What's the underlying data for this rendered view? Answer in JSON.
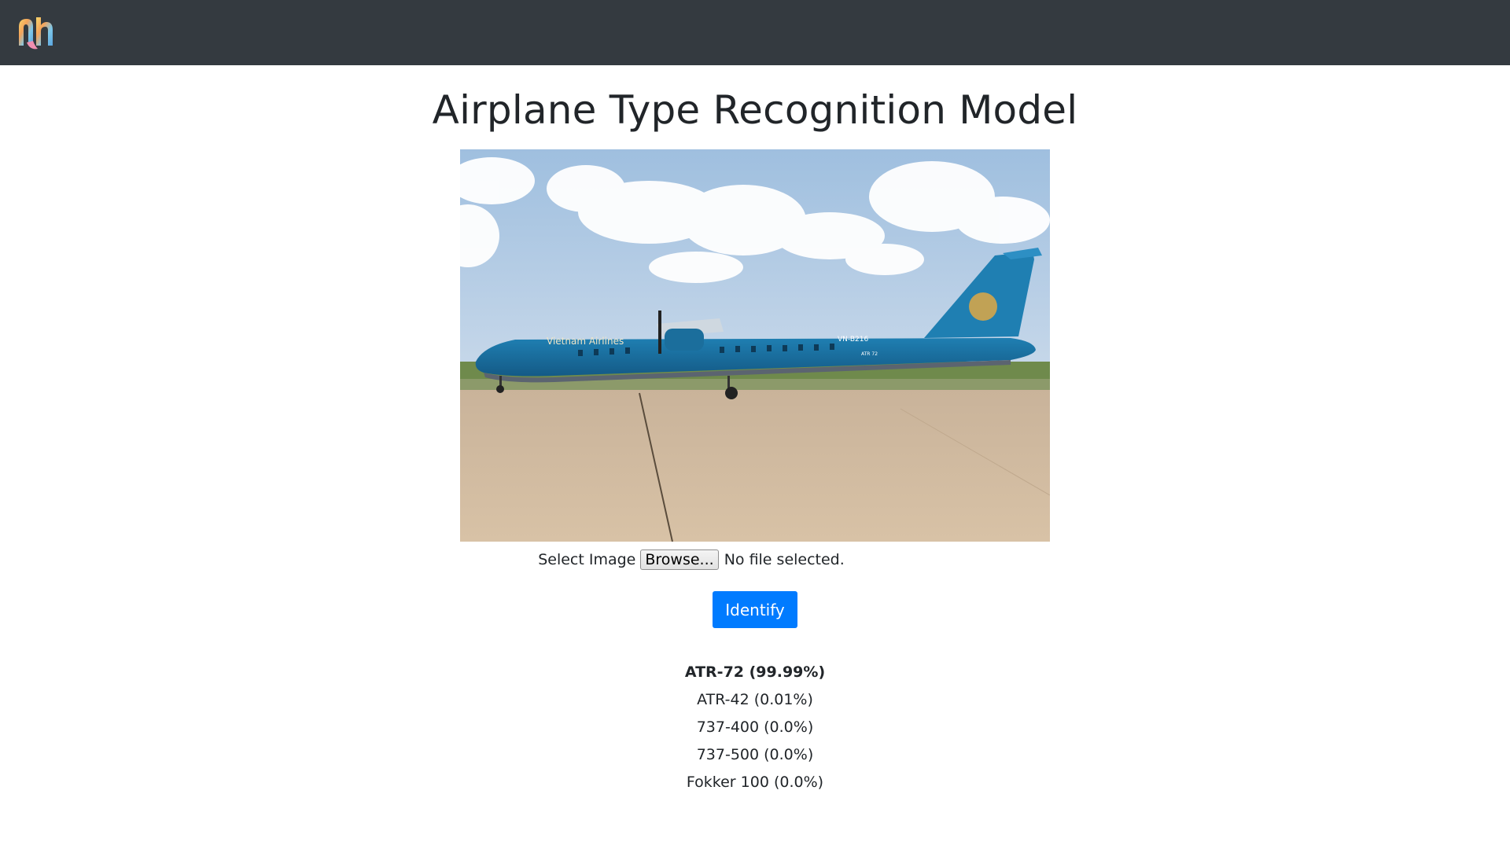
{
  "header": {
    "logo_icon": "colorful-logo-icon"
  },
  "main": {
    "title": "Airplane Type Recognition Model",
    "image": {
      "alt": "Vietnam Airlines ATR-72 aircraft on tarmac",
      "fuselage_text": "Vietnam Airlines",
      "registration": "VN-B216",
      "type_marking": "ATR 72"
    },
    "upload": {
      "label": "Select Image",
      "browse_label": "Browse...",
      "status": "No file selected."
    },
    "identify_label": "Identify",
    "results": [
      "ATR-72 (99.99%)",
      "ATR-42 (0.01%)",
      "737-400 (0.0%)",
      "737-500 (0.0%)",
      "Fokker 100 (0.0%)"
    ]
  },
  "colors": {
    "navbar": "#343a40",
    "primary": "#007bff",
    "text": "#212529"
  }
}
